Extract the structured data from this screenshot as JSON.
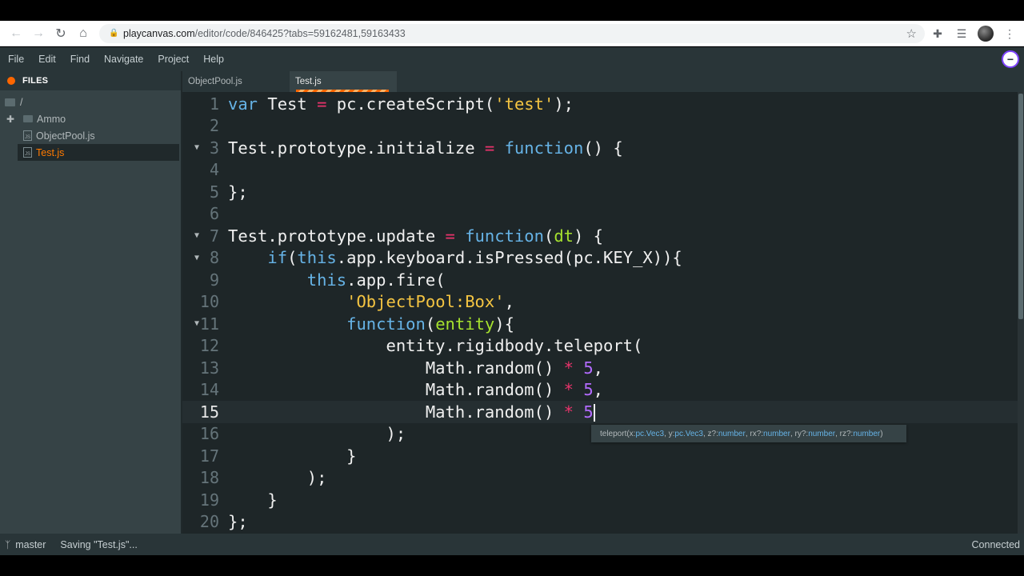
{
  "browser": {
    "url_host": "playcanvas.com",
    "url_path": "/editor/code/846425?tabs=59162481,59163433"
  },
  "menu": {
    "items": [
      "File",
      "Edit",
      "Find",
      "Navigate",
      "Project",
      "Help"
    ]
  },
  "files": {
    "header": "FILES",
    "root": "/",
    "items": [
      "Ammo",
      "ObjectPool.js",
      "Test.js"
    ]
  },
  "tabs": [
    "ObjectPool.js",
    "Test.js"
  ],
  "editor": {
    "current_line": 15,
    "lines": [
      {
        "n": "1"
      },
      {
        "n": "2"
      },
      {
        "n": "3"
      },
      {
        "n": "4"
      },
      {
        "n": "5"
      },
      {
        "n": "6"
      },
      {
        "n": "7"
      },
      {
        "n": "8"
      },
      {
        "n": "9"
      },
      {
        "n": "10"
      },
      {
        "n": "11"
      },
      {
        "n": "12"
      },
      {
        "n": "13"
      },
      {
        "n": "14"
      },
      {
        "n": "15"
      },
      {
        "n": "16"
      },
      {
        "n": "17"
      },
      {
        "n": "18"
      },
      {
        "n": "19"
      },
      {
        "n": "20"
      }
    ],
    "code": {
      "l1_kw": "var",
      "l1_a": " Test ",
      "l1_op": "=",
      "l1_b": " pc.createScript(",
      "l1_str": "'test'",
      "l1_c": ");",
      "l3_a": "Test.prototype.initialize ",
      "l3_op": "=",
      "l3_sp": " ",
      "l3_kw": "function",
      "l3_b": "() {",
      "l5": "};",
      "l7_a": "Test.prototype.update ",
      "l7_op": "=",
      "l7_sp": " ",
      "l7_kw": "function",
      "l7_b": "(",
      "l7_param": "dt",
      "l7_c": ") {",
      "l8_ind": "    ",
      "l8_kw": "if",
      "l8_a": "(",
      "l8_kw2": "this",
      "l8_b": ".app.keyboard.isPressed(pc.KEY_X)){",
      "l9_ind": "        ",
      "l9_kw": "this",
      "l9_a": ".app.fire(",
      "l10_ind": "            ",
      "l10_str": "'ObjectPool:Box'",
      "l10_a": ",",
      "l11_ind": "            ",
      "l11_kw": "function",
      "l11_a": "(",
      "l11_param": "entity",
      "l11_b": "){",
      "l12": "                entity.rigidbody.teleport(",
      "l13_a": "                    Math.random() ",
      "l13_op": "*",
      "l13_sp": " ",
      "l13_num": "5",
      "l13_b": ",",
      "l14_a": "                    Math.random() ",
      "l14_op": "*",
      "l14_sp": " ",
      "l14_num": "5",
      "l14_b": ",",
      "l15_a": "                    Math.random() ",
      "l15_op": "*",
      "l15_sp": " ",
      "l15_num": "5",
      "l16": "                );",
      "l17": "            }",
      "l18": "        );",
      "l19": "    }",
      "l20": "};"
    }
  },
  "tooltip": {
    "p1": "teleport(x: ",
    "t1": "pc.Vec3",
    "p2": ", y: ",
    "t2": "pc.Vec3",
    "p3": ", z?: ",
    "t3": "number",
    "p4": ", rx?: ",
    "t4": "number",
    "p5": ", ry?: ",
    "t5": "number",
    "p6": ", rz?: ",
    "t6": "number",
    "p7": ")"
  },
  "status": {
    "branch": "master",
    "saving": "Saving \"Test.js\"...",
    "connection": "Connected"
  },
  "colors": {
    "accent": "#ff6600",
    "keyword": "#66b3e6",
    "string": "#f5c542",
    "operator": "#e8336b",
    "number": "#b36bff",
    "param": "#a6e22e"
  }
}
